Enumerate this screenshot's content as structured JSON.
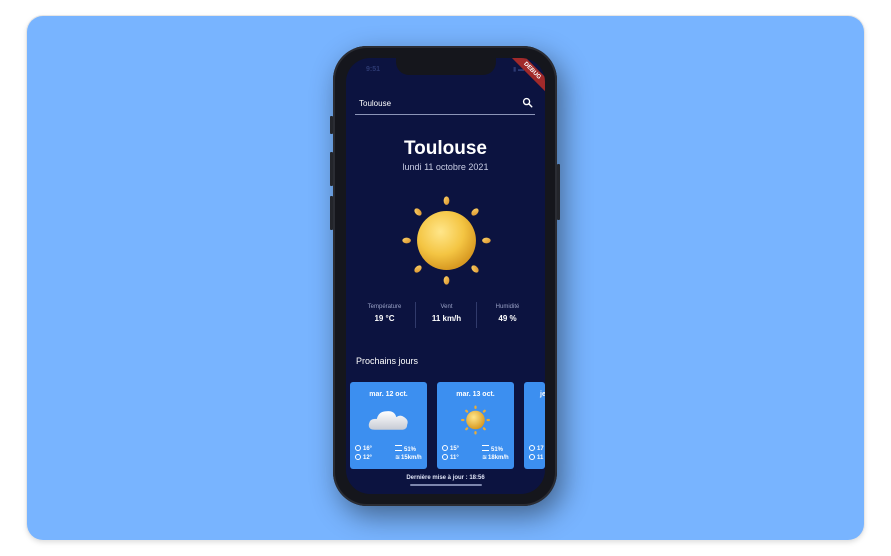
{
  "status": {
    "time": "9:51",
    "icons": "▮ ▬"
  },
  "debug_ribbon": "DEBUG",
  "search": {
    "value": "Toulouse",
    "placeholder": ""
  },
  "current": {
    "city": "Toulouse",
    "date": "lundi 11 octobre 2021",
    "icon": "sun-icon",
    "stats": [
      {
        "label": "Température",
        "value": "19 °C"
      },
      {
        "label": "Vent",
        "value": "11 km/h"
      },
      {
        "label": "Humidité",
        "value": "49 %"
      }
    ]
  },
  "section_title": "Prochains jours",
  "forecast": [
    {
      "date": "mar. 12 oct.",
      "icon": "cloud-icon",
      "max": "16°",
      "min": "12°",
      "humidity": "51%",
      "wind": "15km/h"
    },
    {
      "date": "mar. 13 oct.",
      "icon": "sun-icon",
      "max": "15°",
      "min": "11°",
      "humidity": "51%",
      "wind": "18km/h"
    },
    {
      "date": "je",
      "icon": "",
      "max": "17",
      "min": "11",
      "humidity": "",
      "wind": ""
    }
  ],
  "footer": "Dernière mise à jour : 18:56",
  "colors": {
    "background": "#78b4ff",
    "screen": "#0c1340",
    "card": "#3c8ff0",
    "sun": "#f4c543"
  }
}
